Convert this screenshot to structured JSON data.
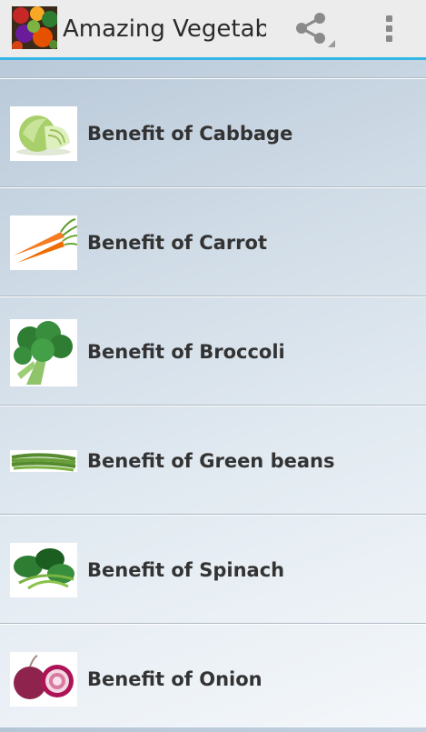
{
  "app": {
    "title": "Amazing Vegetables",
    "accent_color": "#33b5e5",
    "icon": "vegetables-app-icon"
  },
  "toolbar": {
    "share_icon": "share-icon",
    "overflow_icon": "overflow-menu-icon"
  },
  "list": {
    "items": [
      {
        "label": "Benefit of Cabbage",
        "icon": "cabbage-image"
      },
      {
        "label": "Benefit of Carrot",
        "icon": "carrot-image"
      },
      {
        "label": "Benefit of Broccoli",
        "icon": "broccoli-image"
      },
      {
        "label": "Benefit of Green beans",
        "icon": "green-beans-image"
      },
      {
        "label": "Benefit of Spinach",
        "icon": "spinach-image"
      },
      {
        "label": "Benefit of Onion",
        "icon": "onion-image"
      }
    ]
  }
}
